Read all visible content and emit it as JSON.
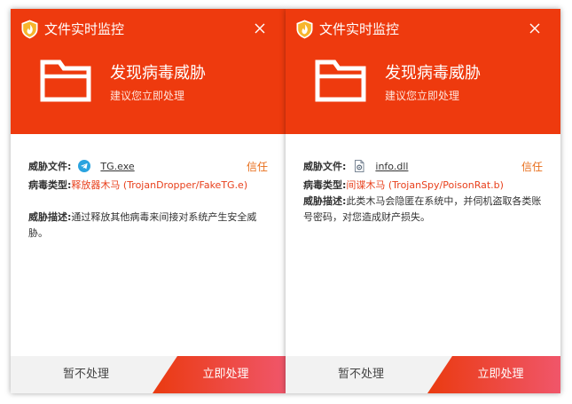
{
  "theme": {
    "accent": "#ee3a0e",
    "threat_text": "#e8401c",
    "trust_link": "#e86e1b"
  },
  "popups": [
    {
      "app_title": "文件实时监控",
      "close_icon": "close-icon",
      "heading": "发现病毒威胁",
      "subheading": "建议您立即处理",
      "file_label": "威胁文件:",
      "file_icon": "telegram-icon",
      "file_name": "TG.exe",
      "trust_label": "信任",
      "type_label": "病毒类型:",
      "type_value": "释放器木马 (TrojanDropper/FakeTG.e)",
      "desc_label": "威胁描述:",
      "desc_value": "通过释放其他病毒来间接对系统产生安全威胁。",
      "ignore_button": "暂不处理",
      "action_button": "立即处理"
    },
    {
      "app_title": "文件实时监控",
      "close_icon": "close-icon",
      "heading": "发现病毒威胁",
      "subheading": "建议您立即处理",
      "file_label": "威胁文件:",
      "file_icon": "document-gear-icon",
      "file_name": "info.dll",
      "trust_label": "信任",
      "type_label": "病毒类型:",
      "type_value": "间谍木马 (TrojanSpy/PoisonRat.b)",
      "desc_label": "威胁描述:",
      "desc_value": "此类木马会隐匿在系统中，并伺机盗取各类账号密码，对您造成财产损失。",
      "ignore_button": "暂不处理",
      "action_button": "立即处理"
    }
  ]
}
